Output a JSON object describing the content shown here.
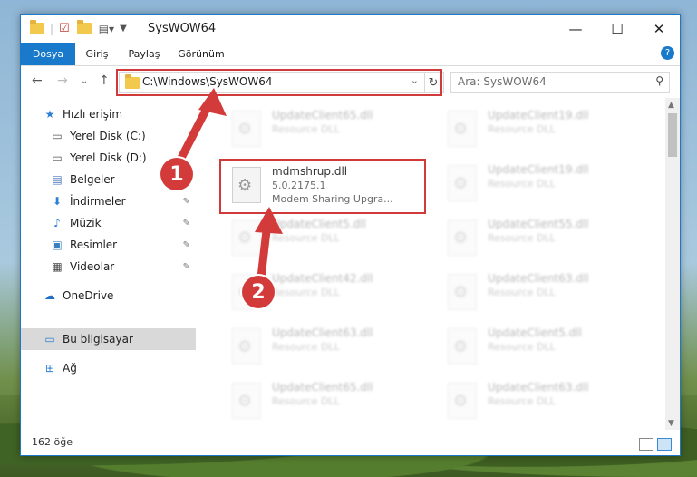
{
  "window": {
    "title": "SysWOW64",
    "controls": {
      "minimize": "—",
      "maximize": "☐",
      "close": "✕"
    }
  },
  "ribbon": {
    "tabs": [
      "Dosya",
      "Giriş",
      "Paylaş",
      "Görünüm"
    ],
    "help": "?"
  },
  "address": {
    "path": "C:\\Windows\\SysWOW64",
    "search_placeholder": "Ara: SysWOW64"
  },
  "sidebar": {
    "items": [
      {
        "label": "Hızlı erişim",
        "icon": "star-icon"
      },
      {
        "label": "Yerel Disk (C:)",
        "icon": "drive-icon"
      },
      {
        "label": "Yerel Disk (D:)",
        "icon": "drive-icon"
      },
      {
        "label": "Belgeler",
        "icon": "documents-icon"
      },
      {
        "label": "İndirmeler",
        "icon": "download-icon"
      },
      {
        "label": "Müzik",
        "icon": "music-icon"
      },
      {
        "label": "Resimler",
        "icon": "pictures-icon"
      },
      {
        "label": "Videolar",
        "icon": "video-icon"
      },
      {
        "label": "OneDrive",
        "icon": "cloud-icon"
      },
      {
        "label": "Bu bilgisayar",
        "icon": "computer-icon"
      },
      {
        "label": "Ağ",
        "icon": "network-icon"
      }
    ]
  },
  "files": {
    "highlighted": {
      "name": "mdmshrup.dll",
      "version": "5.0.2175.1",
      "description": "Modem Sharing Upgra..."
    },
    "left_column": [
      {
        "name": "UpdateClient65.dll",
        "type": "Resource DLL"
      },
      {
        "name": "UpdateClient5.dll",
        "type": "Resource DLL"
      },
      {
        "name": "UpdateClient42.dll",
        "type": "Resource DLL"
      },
      {
        "name": "UpdateClient63.dll",
        "type": "Resource DLL"
      },
      {
        "name": "UpdateClient65.dll",
        "type": "Resource DLL"
      }
    ],
    "right_column": [
      {
        "name": "UpdateClient19.dll",
        "type": "Resource DLL"
      },
      {
        "name": "UpdateClient19.dll",
        "type": "Resource DLL"
      },
      {
        "name": "UpdateClient55.dll",
        "type": "Resource DLL"
      },
      {
        "name": "UpdateClient63.dll",
        "type": "Resource DLL"
      },
      {
        "name": "UpdateClient5.dll",
        "type": "Resource DLL"
      },
      {
        "name": "UpdateClient63.dll",
        "type": "Resource DLL"
      }
    ]
  },
  "status": {
    "item_count": "162 öğe"
  },
  "annotations": {
    "step1": "1",
    "step2": "2"
  },
  "colors": {
    "accent": "#1979ca",
    "highlight": "#d03a3a"
  }
}
